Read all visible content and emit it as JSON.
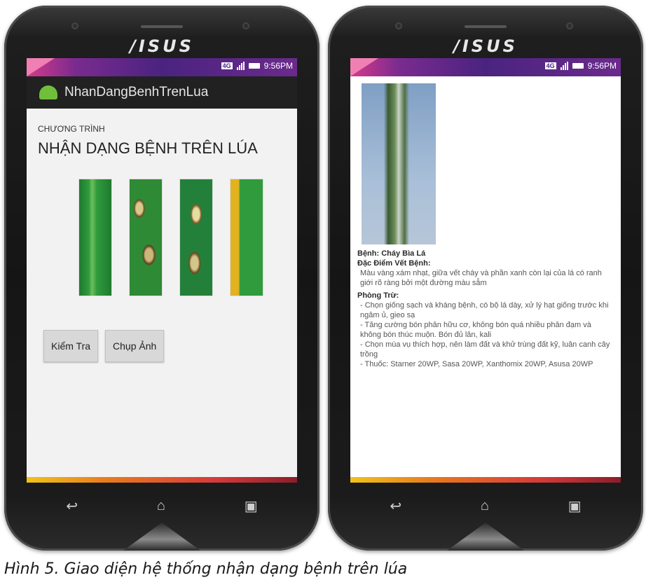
{
  "device": {
    "brand": "/ISUS"
  },
  "status": {
    "network": "4G",
    "time": "9:56PM"
  },
  "left_screen": {
    "app_title": "NhanDangBenhTrenLua",
    "label_small": "CHƯƠNG TRÌNH",
    "main_title": "NHẬN DẠNG BỆNH TRÊN LÚA",
    "buttons": {
      "check": "Kiểm Tra",
      "capture": "Chụp Ảnh"
    }
  },
  "right_screen": {
    "disease_label": "Bệnh: Cháy Bìa Lá",
    "features_heading": "Đặc Điểm Vết Bệnh:",
    "features_text": "Màu vàng xám nhạt, giữa vết cháy và phần xanh còn lại của lá có ranh giới rõ ràng bởi một đường màu sẫm",
    "prevention_heading": "Phòng Trừ:",
    "prevention_items": [
      "- Chọn giống sạch và kháng bệnh, có bộ lá dày, xử lý hạt giống trước khi ngâm ủ, gieo sạ",
      "- Tăng cường bón phân hữu cơ, không bón quá nhiều phân đạm và không bón thúc muộn. Bón đủ lân, kali",
      "- Chọn mùa vụ thích hợp, nên làm đất và khử trùng đất kỹ, luân canh cây trồng",
      "- Thuốc: Starner 20WP, Sasa 20WP, Xanthomix 20WP, Asusa 20WP"
    ]
  },
  "nav": {
    "back": "↩",
    "home": "⌂",
    "recents": "▣"
  },
  "caption": "Hình 5. Giao diện hệ thống nhận dạng bệnh trên lúa"
}
